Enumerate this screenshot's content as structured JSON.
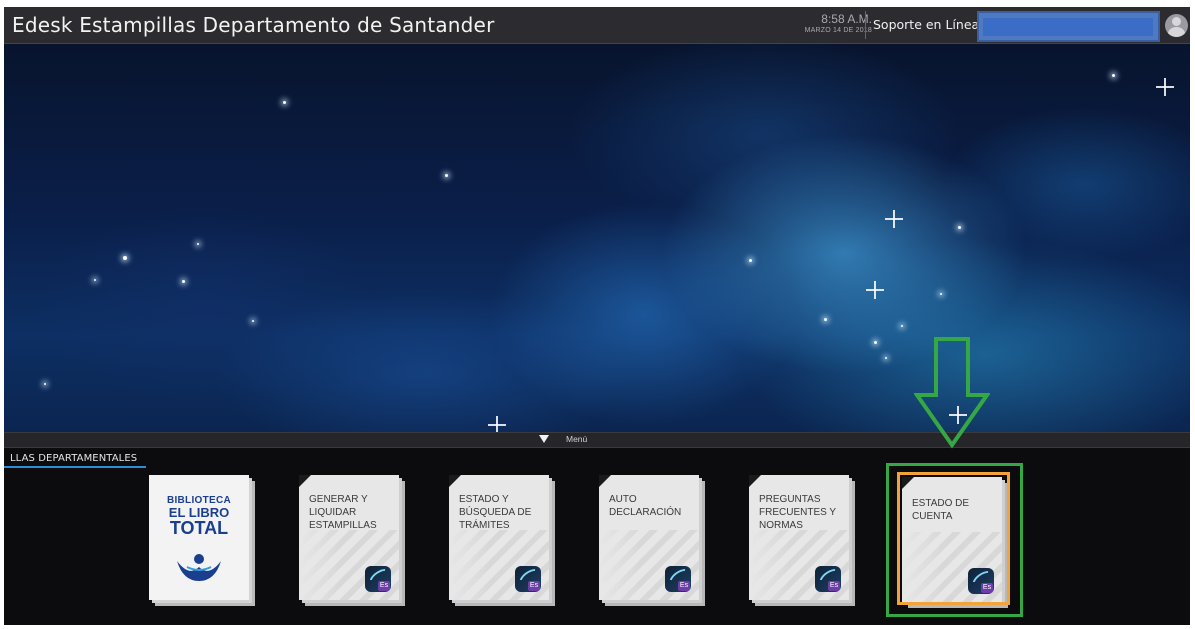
{
  "header": {
    "app_title": "Edesk Estampillas Departamento de Santander",
    "time": "8:58 A.M.",
    "date": "MARZO 14 DE 2018",
    "support_label": "Soporte en Línea",
    "user_name": ""
  },
  "menu_bar": {
    "label": "Menú"
  },
  "section": {
    "title": "LLAS DEPARTAMENTALES"
  },
  "library": {
    "line1": "BIBLIOTECA",
    "line2": "EL LIBRO",
    "line3": "TOTAL"
  },
  "tiles": [
    {
      "label": "GENERAR Y LIQUIDAR ESTAMPILLAS",
      "icon": "es-app-icon"
    },
    {
      "label": "ESTADO Y BÚSQUEDA DE TRÁMITES",
      "icon": "es-app-icon"
    },
    {
      "label": "AUTO DECLARACIÓN",
      "icon": "es-app-icon"
    },
    {
      "label": "PREGUNTAS FRECUENTES Y NORMAS",
      "icon": "es-app-icon"
    },
    {
      "label": "ESTADO DE CUENTA",
      "icon": "es-app-icon"
    }
  ],
  "icon_badge_text": "Es",
  "colors": {
    "header_bg": "#2c2c30",
    "accent_blue": "#2a8fd6",
    "user_box": "#4f79c3",
    "annotation_green": "#35a845",
    "annotation_orange": "#f0a43a"
  }
}
